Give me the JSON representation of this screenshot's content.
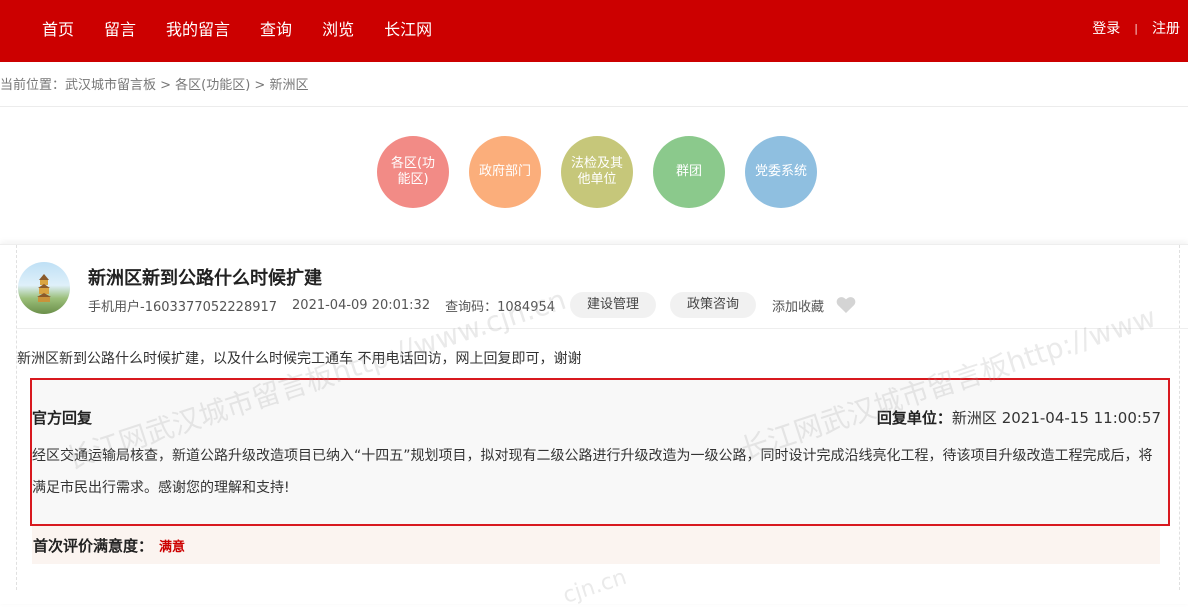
{
  "nav": {
    "items": [
      "首页",
      "留言",
      "我的留言",
      "查询",
      "浏览",
      "长江网"
    ],
    "login": "登录",
    "separator": "|",
    "register": "注册"
  },
  "breadcrumb": "当前位置：武汉城市留言板 > 各区(功能区) > 新洲区",
  "categories": [
    {
      "label": "各区(功能区)",
      "color": "#f28b86"
    },
    {
      "label": "政府部门",
      "color": "#fbae7b"
    },
    {
      "label": "法检及其他单位",
      "color": "#c6c77a"
    },
    {
      "label": "群团",
      "color": "#8bc98c"
    },
    {
      "label": "党委系统",
      "color": "#8fbfe0"
    }
  ],
  "post": {
    "title": "新洲区新到公路什么时候扩建",
    "user": "手机用户-1603377052228917",
    "datetime": "2021-04-09 20:01:32",
    "query_code": "查询码：1084954",
    "tags": [
      "建设管理",
      "政策咨询"
    ],
    "favorite": "添加收藏",
    "content": "新洲区新到公路什么时候扩建，以及什么时候完工通车 不用电话回访，网上回复即可，谢谢"
  },
  "reply": {
    "heading": "官方回复",
    "unit_label": "回复单位：",
    "unit": "新洲区 2021-04-15 11:00:57",
    "text": "经区交通运输局核查，新道公路升级改造项目已纳入“十四五”规划项目，拟对现有二级公路进行升级改造为一级公路，同时设计完成沿线亮化工程，待该项目升级改造工程完成后，将满足市民出行需求。感谢您的理解和支持!"
  },
  "rating": {
    "label": "首次评价满意度：",
    "value": "满意"
  },
  "watermark": {
    "text1": "长江网武汉城市留言板http://www.cjn.cn",
    "text2": "长江网武汉城市留言板http://www",
    "text3": "cjn.cn"
  },
  "colors": {
    "brand_red": "#cc0000",
    "reply_border": "#d8191f"
  }
}
